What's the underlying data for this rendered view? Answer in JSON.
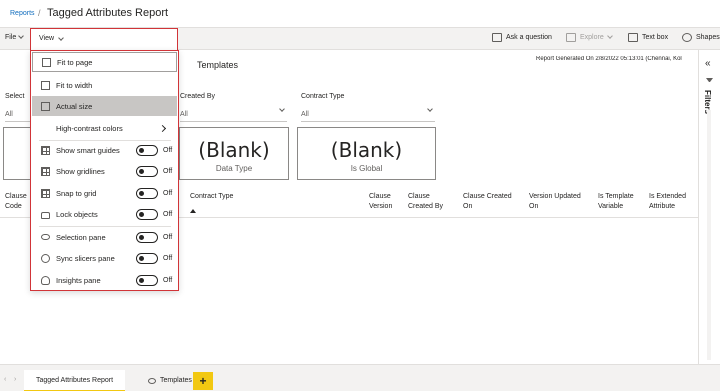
{
  "header": {
    "breadcrumb": "Reports",
    "separator": "/",
    "title": "Tagged Attributes Report"
  },
  "ribbon": {
    "file": "File",
    "view": "View",
    "ask_question": "Ask a question",
    "explore": "Explore",
    "text_box": "Text box",
    "shapes": "Shapes"
  },
  "canvas": {
    "report_generated": "Report Generated On 2/8/2022 05:13:01 (Chennai, Kol",
    "templates_label": "Templates",
    "slicers": [
      {
        "title": "Select",
        "value": "All"
      },
      {
        "title": "Created By",
        "value": "All"
      },
      {
        "title": "Contract Type",
        "value": "All"
      }
    ],
    "cards": [
      {
        "value": "(Blank)",
        "label": "Data Type"
      },
      {
        "value": "(Blank)",
        "label": "Is Global"
      }
    ],
    "table_headers": [
      "Clause Code",
      "Contract Type",
      "Clause Version",
      "Clause Created By",
      "Clause Created On",
      "Version Updated On",
      "Is Template Variable",
      "Is Extended Attribute"
    ]
  },
  "filters_pane": {
    "label": "Filters"
  },
  "view_menu": {
    "items": [
      {
        "label": "Fit to page",
        "icon": "fit-page-icon"
      },
      {
        "label": "Fit to width",
        "icon": "fit-width-icon"
      },
      {
        "label": "Actual size",
        "icon": "actual-size-icon"
      },
      {
        "label": "High-contrast colors",
        "icon": "none"
      },
      {
        "label": "Show smart guides",
        "icon": "smart-guides-icon",
        "state": "Off"
      },
      {
        "label": "Show gridlines",
        "icon": "gridlines-icon",
        "state": "Off"
      },
      {
        "label": "Snap to grid",
        "icon": "snap-grid-icon",
        "state": "Off"
      },
      {
        "label": "Lock objects",
        "icon": "lock-icon",
        "state": "Off"
      },
      {
        "label": "Selection pane",
        "icon": "eye-icon",
        "state": "Off"
      },
      {
        "label": "Sync slicers pane",
        "icon": "sync-icon",
        "state": "Off"
      },
      {
        "label": "Insights pane",
        "icon": "bulb-icon",
        "state": "Off"
      }
    ]
  },
  "page_tabs": [
    {
      "label": "Tagged Attributes Report",
      "active": true
    },
    {
      "label": "Templates",
      "active": false
    }
  ],
  "add_page": "+",
  "colors": {
    "accent_yellow": "#f2c811",
    "highlight_red": "#d13438",
    "link_blue": "#0f6cbd"
  }
}
